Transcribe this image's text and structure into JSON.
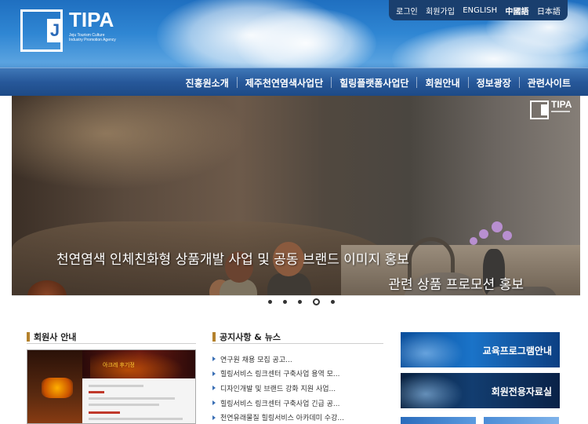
{
  "logo": {
    "name": "TIPA",
    "letter": "J",
    "subtitle": "Jeju Tourism Culture Industry Promotion Agency"
  },
  "utility_nav": [
    "로그인",
    "회원가입",
    "ENGLISH",
    "中國語",
    "日本語"
  ],
  "main_nav": [
    "진흥원소개",
    "제주천연염색사업단",
    "힐링플랫폼사업단",
    "회원안내",
    "정보광장",
    "관련사이트"
  ],
  "banner": {
    "logo_text": "TIPA",
    "line1": "천연염색 인체친화형 상품개발 사업 및 공동 브랜드 이미지 홍보",
    "line2": "관련 상품 프로모션 홍보",
    "slide_count": 5,
    "active_slide": 4
  },
  "member_section": {
    "title": "회원사 안내",
    "thumb_caption": "아크레 후기정"
  },
  "notice_section": {
    "title": "공지사항 & 뉴스",
    "items": [
      "연구원 채용 모집 공고...",
      "힐링서비스 링크센터 구축사업 용역 모...",
      "디자인개발 및 브랜드 강화 지원 사업...",
      "힐링서비스 링크센터 구축사업 긴급 공...",
      "천연유래물질 힐링서비스 아카데미 수강..."
    ]
  },
  "quick_banners": [
    "교육프로그램안내",
    "회원전용자료실"
  ],
  "colors": {
    "header_blue": "#2f86d3",
    "nav_blue": "#27589a",
    "section_accent": "#b4812c",
    "bullet_blue": "#3a6fb5"
  }
}
